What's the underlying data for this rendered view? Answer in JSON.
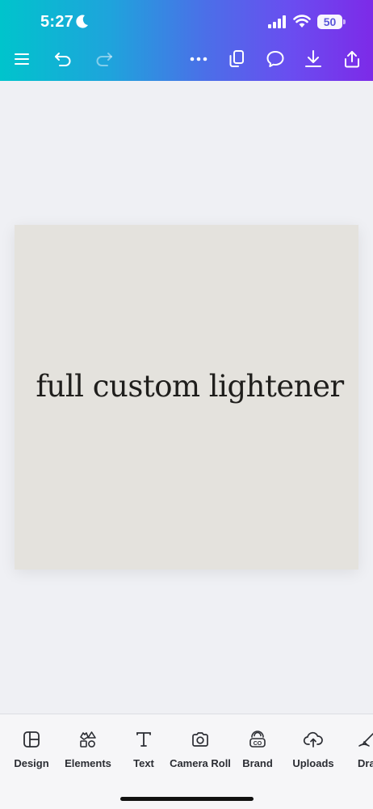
{
  "status_bar": {
    "time": "5:27",
    "battery_level": "50"
  },
  "toolbar": {
    "icons": [
      "menu-icon",
      "undo-icon",
      "redo-icon",
      "more-icon",
      "pages-icon",
      "comment-icon",
      "download-icon",
      "share-icon"
    ]
  },
  "canvas": {
    "text": "full custom lightener",
    "background_color": "#e4e2dd"
  },
  "bottom_tools": [
    {
      "label": "Design",
      "icon": "layout-icon"
    },
    {
      "label": "Elements",
      "icon": "shapes-icon"
    },
    {
      "label": "Text",
      "icon": "text-icon"
    },
    {
      "label": "Camera Roll",
      "icon": "camera-icon"
    },
    {
      "label": "Brand",
      "icon": "brand-icon"
    },
    {
      "label": "Uploads",
      "icon": "upload-cloud-icon"
    },
    {
      "label": "Dra",
      "icon": "draw-icon"
    }
  ],
  "colors": {
    "gradient_start": "#00c4cc",
    "gradient_end": "#7d2ae8"
  }
}
